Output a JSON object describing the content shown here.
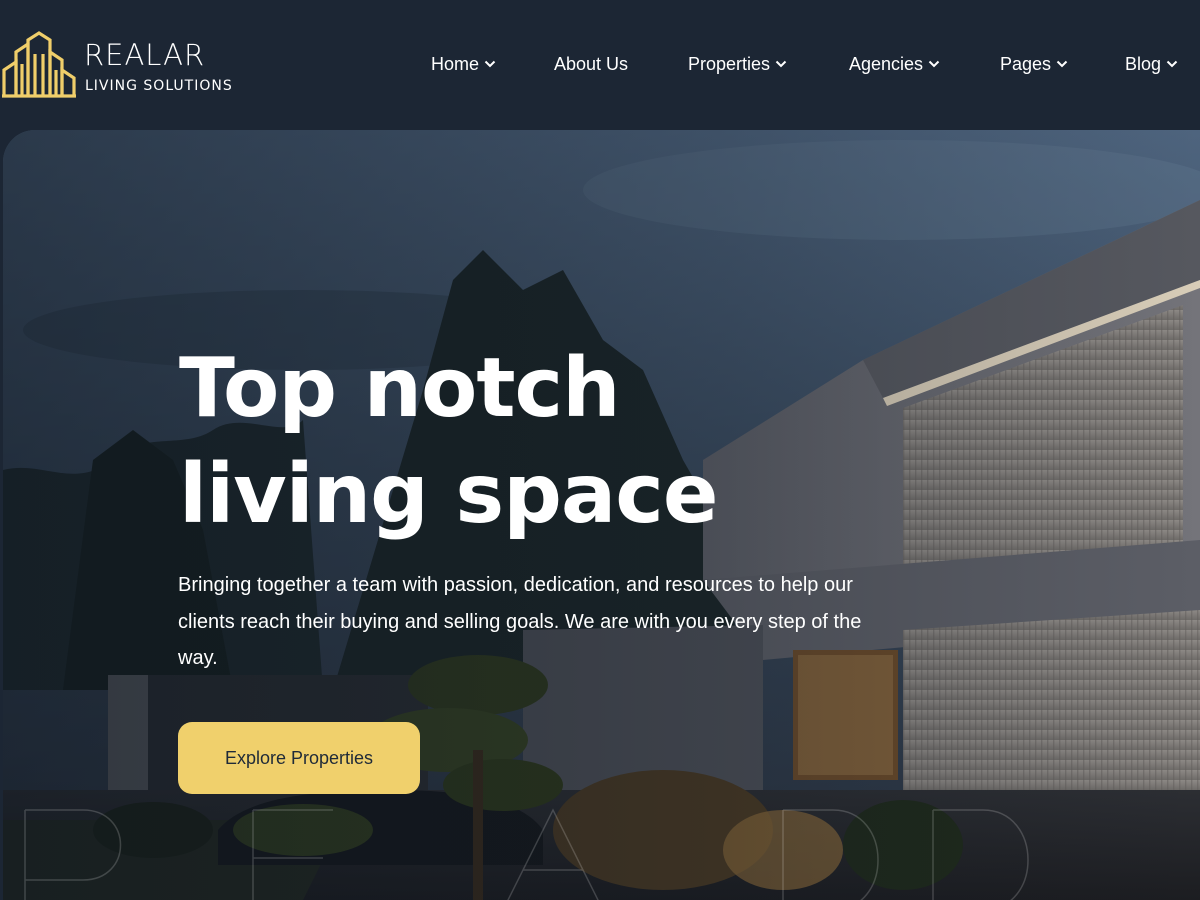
{
  "brand": {
    "name": "REALAR",
    "tagline": "LIVING SOLUTIONS",
    "accent_color": "#f0ce6a",
    "icon": "building-logo-icon"
  },
  "nav": {
    "items": [
      {
        "label": "Home",
        "has_dropdown": true
      },
      {
        "label": "About Us",
        "has_dropdown": false
      },
      {
        "label": "Properties",
        "has_dropdown": true
      },
      {
        "label": "Agencies",
        "has_dropdown": true
      },
      {
        "label": "Pages",
        "has_dropdown": true
      },
      {
        "label": "Blog",
        "has_dropdown": true
      }
    ],
    "dropdown_icon": "chevron-down-icon"
  },
  "hero": {
    "title_line1": "Top notch",
    "title_line2": "living space",
    "description": "Bringing together a team with passion, dedication, and resources to help our clients reach their buying and selling goals. We are with you every step of the way.",
    "cta_label": "Explore Properties",
    "cta_color": "#f0d06c"
  },
  "colors": {
    "header_bg": "#1c2634",
    "text": "#ffffff"
  }
}
